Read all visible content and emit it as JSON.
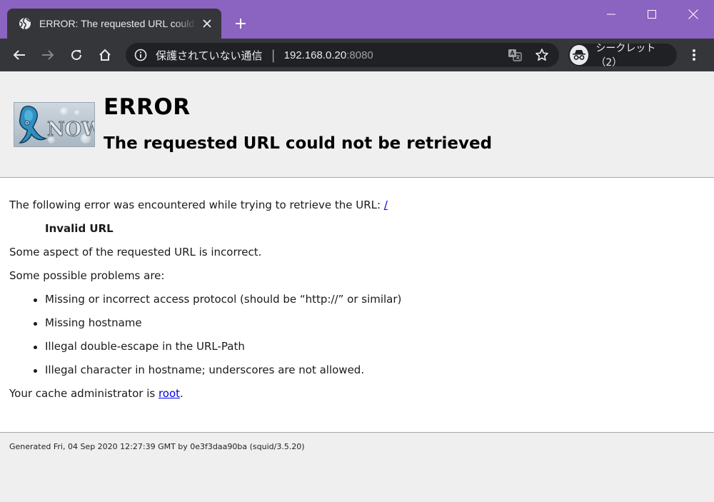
{
  "browser": {
    "tab_title": "ERROR: The requested URL could not be retrieved",
    "address": {
      "security_label": "保護されていない通信",
      "separator": "|",
      "host": "192.168.0.20",
      "port": ":8080"
    },
    "profile_label": "シークレット（2）",
    "colors": {
      "frame": "#8b63c0",
      "toolbar": "#35363a",
      "omnibox": "#202124"
    }
  },
  "page": {
    "logo_text": "NOW",
    "title": "ERROR",
    "subtitle": "The requested URL could not be retrieved",
    "intro_text": "The following error was encountered while trying to retrieve the URL: ",
    "intro_link": "/",
    "error_name": "Invalid URL",
    "description": "Some aspect of the requested URL is incorrect.",
    "problems_heading": "Some possible problems are:",
    "problems": [
      "Missing or incorrect access protocol (should be “http://” or similar)",
      "Missing hostname",
      "Illegal double-escape in the URL-Path",
      "Illegal character in hostname; underscores are not allowed."
    ],
    "admin_prefix": "Your cache administrator is ",
    "admin_link": "root",
    "admin_suffix": ".",
    "footer": "Generated Fri, 04 Sep 2020 12:27:39 GMT by 0e3f3daa90ba (squid/3.5.20)"
  }
}
